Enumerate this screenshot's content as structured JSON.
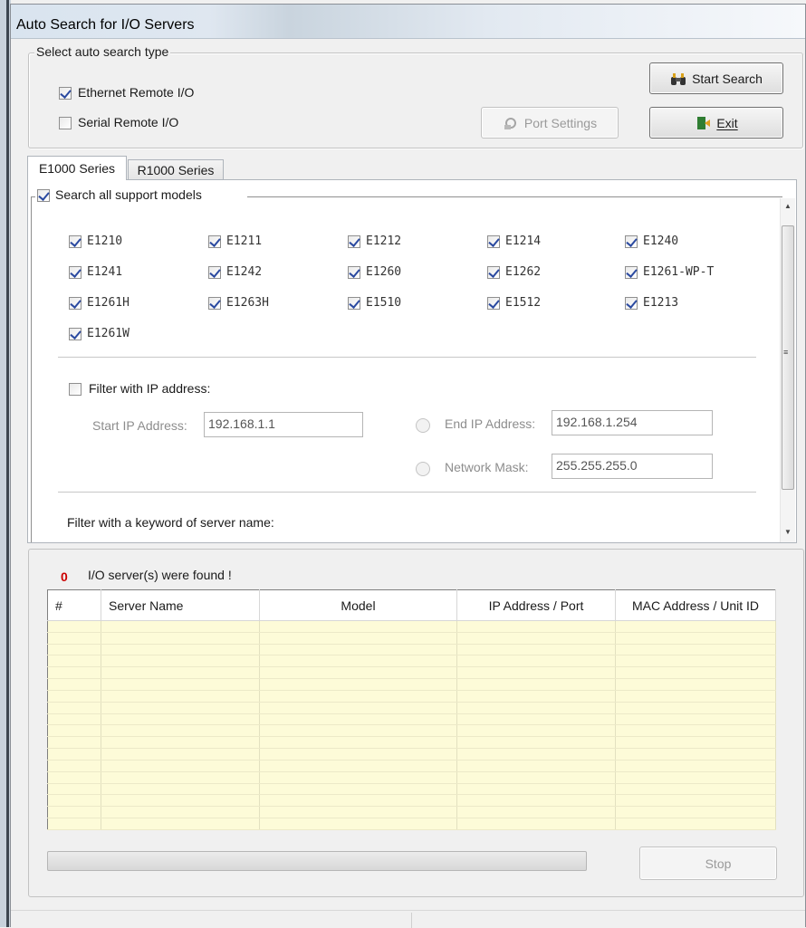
{
  "window": {
    "title": "Auto Search for I/O Servers"
  },
  "search_type": {
    "legend": "Select auto search type",
    "ethernet": {
      "label": "Ethernet Remote I/O",
      "checked": true
    },
    "serial": {
      "label": "Serial Remote I/O",
      "checked": false
    }
  },
  "buttons": {
    "start_search": "Start Search",
    "port_settings": "Port Settings",
    "exit": "Exit",
    "stop": "Stop"
  },
  "tabs": [
    {
      "label": "E1000 Series",
      "active": true
    },
    {
      "label": "R1000 Series",
      "active": false
    }
  ],
  "models": {
    "search_all_label": "Search all support models",
    "search_all_checked": true,
    "items": [
      {
        "name": "E1210",
        "checked": true
      },
      {
        "name": "E1211",
        "checked": true
      },
      {
        "name": "E1212",
        "checked": true
      },
      {
        "name": "E1214",
        "checked": true
      },
      {
        "name": "E1240",
        "checked": true
      },
      {
        "name": "E1241",
        "checked": true
      },
      {
        "name": "E1242",
        "checked": true
      },
      {
        "name": "E1260",
        "checked": true
      },
      {
        "name": "E1262",
        "checked": true
      },
      {
        "name": "E1261-WP-T",
        "checked": true
      },
      {
        "name": "E1261H",
        "checked": true
      },
      {
        "name": "E1263H",
        "checked": true
      },
      {
        "name": "E1510",
        "checked": true
      },
      {
        "name": "E1512",
        "checked": true
      },
      {
        "name": "E1213",
        "checked": true
      },
      {
        "name": "E1261W",
        "checked": true
      }
    ]
  },
  "ip_filter": {
    "label": "Filter with IP address:",
    "checked": false,
    "start_label": "Start IP Address:",
    "start_value": "192.168.1.1",
    "end_label": "End IP Address:",
    "end_value": "192.168.1.254",
    "mask_label": "Network Mask:",
    "mask_value": "255.255.255.0"
  },
  "keyword_filter": {
    "label": "Filter with a keyword of server name:"
  },
  "results": {
    "count": "0",
    "found_text": "I/O server(s) were found !",
    "columns": [
      "#",
      "Server Name",
      "Model",
      "IP Address / Port",
      "MAC Address / Unit ID"
    ],
    "row_count": 18
  },
  "progress": {
    "value": 0
  },
  "colors": {
    "accent_count": "#cc0000",
    "table_bg": "#fdfbd8"
  }
}
